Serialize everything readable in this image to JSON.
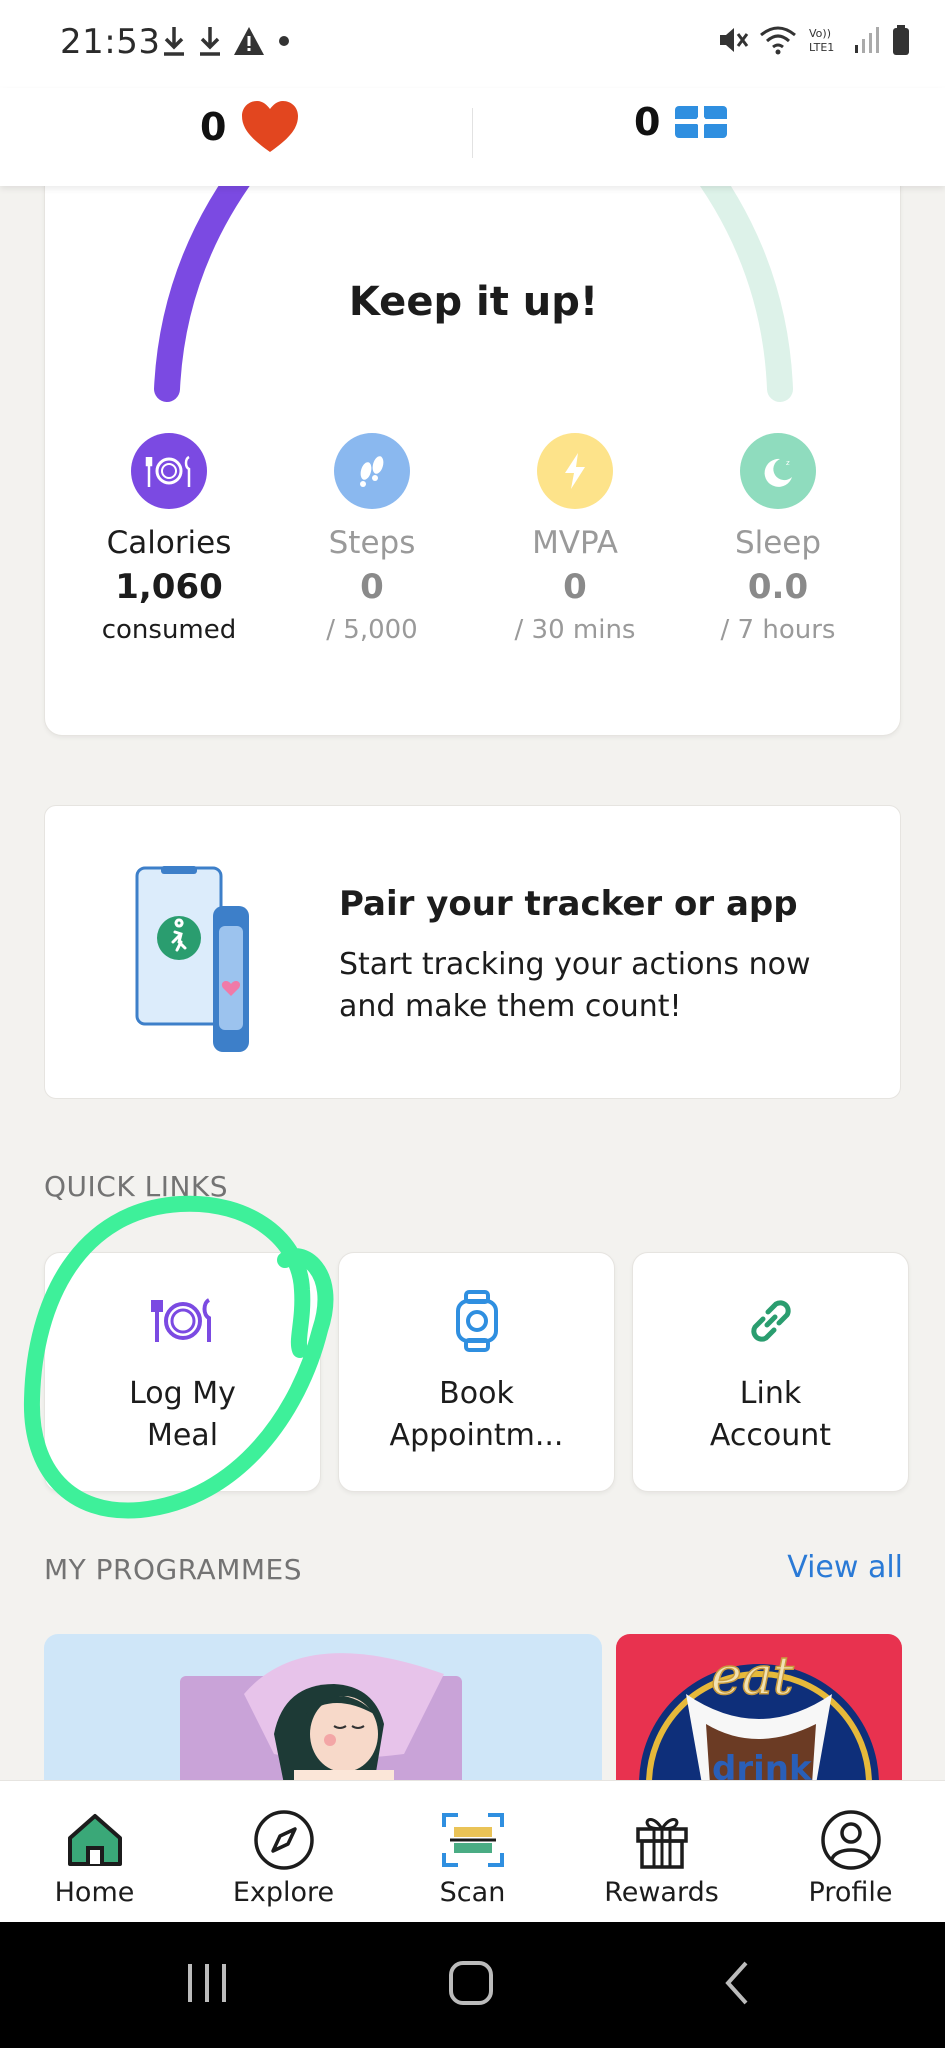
{
  "status_bar": {
    "time": "21:53"
  },
  "top_counters": {
    "hearts": "0",
    "tickets": "0"
  },
  "summary": {
    "headline": "Keep it up!",
    "metrics": [
      {
        "label": "Calories",
        "value": "1,060",
        "sub": "consumed",
        "color": "#7b4ae2"
      },
      {
        "label": "Steps",
        "value": "0",
        "sub": "/ 5,000",
        "color": "#8ab8ef"
      },
      {
        "label": "MVPA",
        "value": "0",
        "sub": "/ 30 mins",
        "color": "#fde38a"
      },
      {
        "label": "Sleep",
        "value": "0.0",
        "sub": "/ 7 hours",
        "color": "#8fdcbe"
      }
    ]
  },
  "pair_card": {
    "title": "Pair your tracker or app",
    "description": "Start tracking your actions now and make them count!"
  },
  "quick_links": {
    "title": "QUICK LINKS",
    "items": [
      {
        "label_line1": "Log My",
        "label_line2": "Meal",
        "icon": "plate-cutlery-icon"
      },
      {
        "label_line1": "Book",
        "label_line2": "Appointm...",
        "icon": "watch-icon"
      },
      {
        "label_line1": "Link",
        "label_line2": "Account",
        "icon": "link-icon"
      }
    ]
  },
  "programmes": {
    "title": "MY PROGRAMMES",
    "view_all": "View all"
  },
  "bottom_nav": {
    "items": [
      {
        "label": "Home",
        "icon": "home-icon"
      },
      {
        "label": "Explore",
        "icon": "compass-icon"
      },
      {
        "label": "Scan",
        "icon": "scan-icon"
      },
      {
        "label": "Rewards",
        "icon": "gift-icon"
      },
      {
        "label": "Profile",
        "icon": "profile-icon"
      }
    ]
  },
  "colors": {
    "accent_purple": "#7b4ae2",
    "accent_blue": "#2a7ad6",
    "accent_green": "#2a9d6f",
    "highlight": "#3ef09a"
  }
}
